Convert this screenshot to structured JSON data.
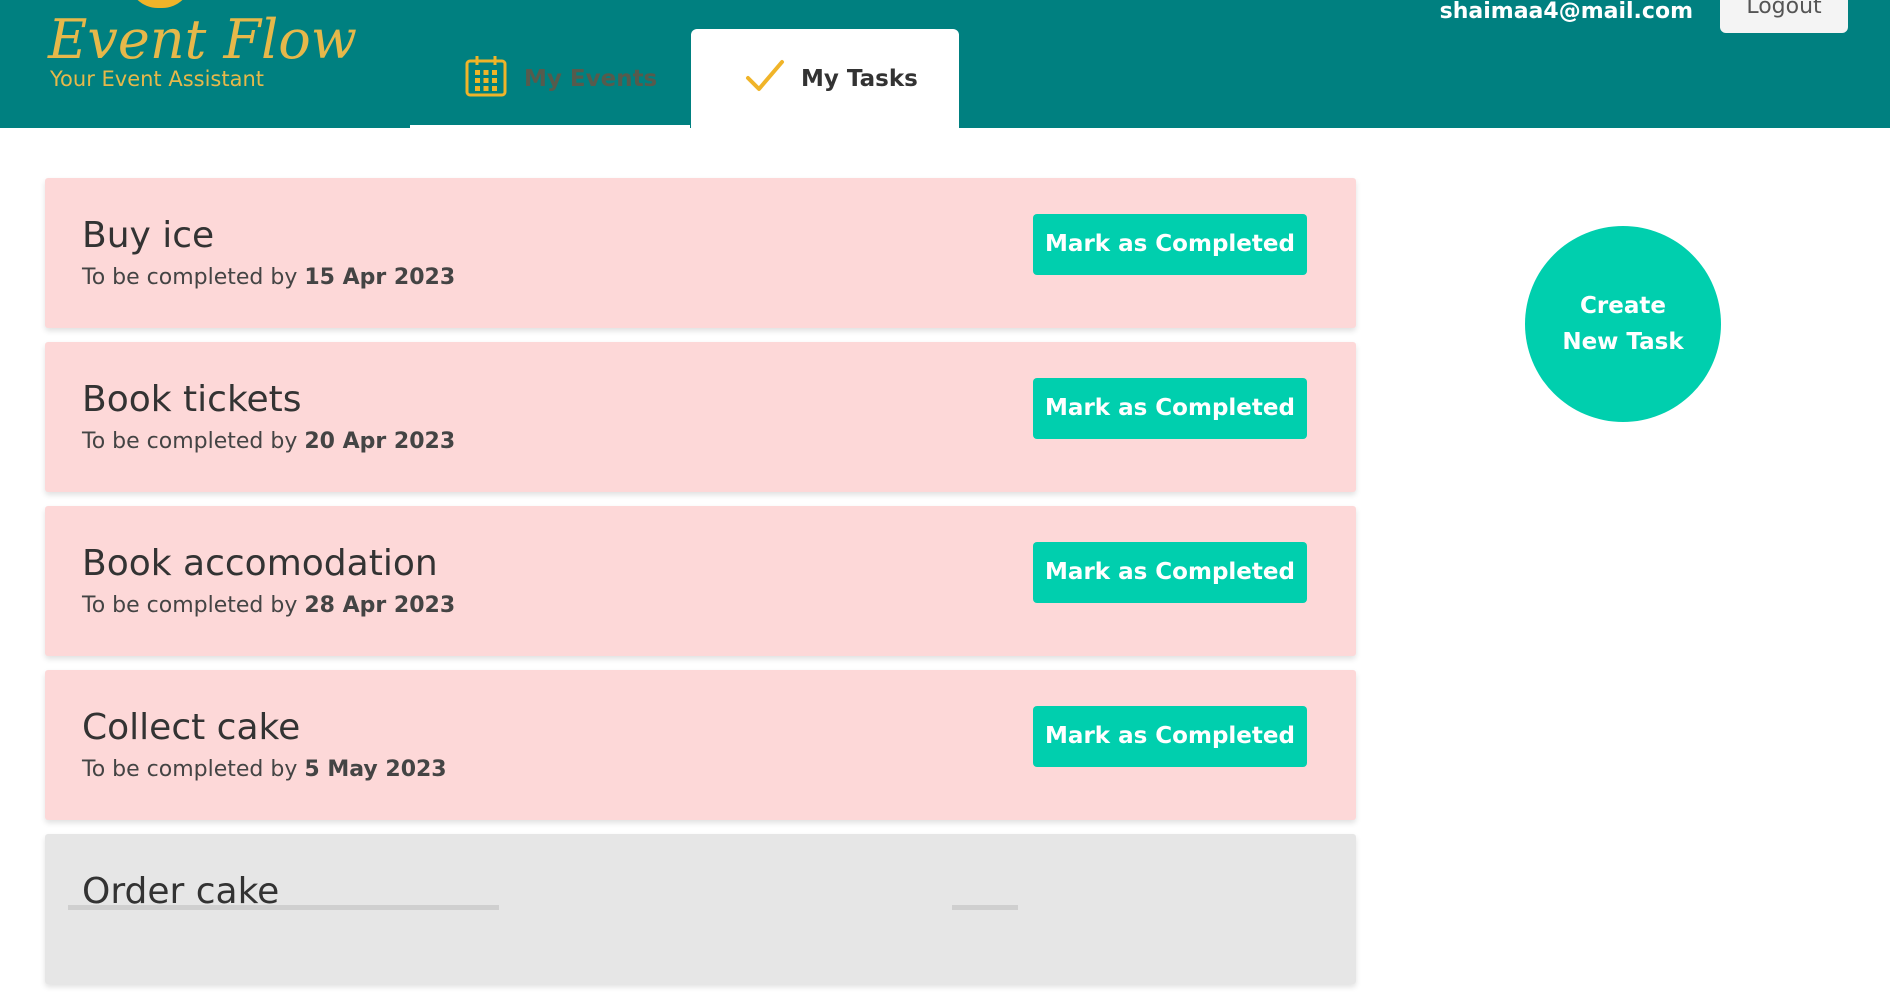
{
  "brand": {
    "title": "Event Flow",
    "tagline": "Your Event Assistant",
    "accent": "#e6b84a",
    "header_bg": "#008080"
  },
  "user": {
    "email": "shaimaa4@mail.com",
    "logout_label": "Logout"
  },
  "tabs": [
    {
      "label": "My Events",
      "icon": "calendar-icon",
      "active": false
    },
    {
      "label": "My Tasks",
      "icon": "checkmark-icon",
      "active": true
    }
  ],
  "tasks": [
    {
      "title": "Buy ice",
      "due_prefix": "To be completed by",
      "due_date": "15 Apr 2023",
      "action": "Mark as Completed",
      "completed": false
    },
    {
      "title": "Book tickets",
      "due_prefix": "To be completed by",
      "due_date": "20 Apr 2023",
      "action": "Mark as Completed",
      "completed": false
    },
    {
      "title": "Book accomodation",
      "due_prefix": "To be completed by",
      "due_date": "28 Apr 2023",
      "action": "Mark as Completed",
      "completed": false
    },
    {
      "title": "Collect cake",
      "due_prefix": "To be completed by",
      "due_date": "5 May 2023",
      "action": "Mark as Completed",
      "completed": false
    },
    {
      "title": "Order cake",
      "completed": true
    }
  ],
  "create_task": {
    "line1": "Create",
    "line2": "New Task"
  },
  "colors": {
    "pending_card": "#fdd8d8",
    "completed_card": "#e6e6e6",
    "button": "#00cfae"
  }
}
